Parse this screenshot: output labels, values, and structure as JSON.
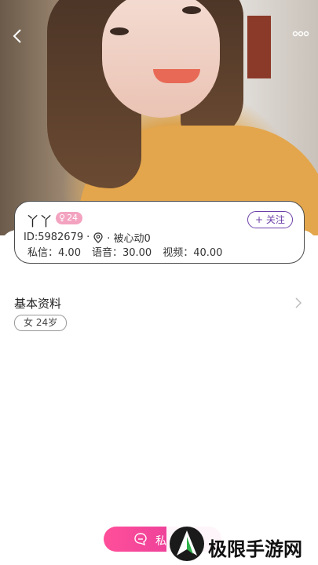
{
  "profile": {
    "name": "丫丫",
    "gender_symbol": "♀",
    "age_badge": "24",
    "id_text": "ID:5982679",
    "separator": "·",
    "liked_text": "· 被心动0",
    "follow_label": "+ 关注",
    "prices": [
      {
        "label": "私信：",
        "value": "4.00"
      },
      {
        "label": "语音：",
        "value": "30.00"
      },
      {
        "label": "视频：",
        "value": "40.00"
      }
    ]
  },
  "basic_info": {
    "title": "基本资料",
    "tag": "女 24岁"
  },
  "chat_button": {
    "label": "私"
  },
  "watermark": {
    "text": "极限手游网"
  },
  "icons": {
    "back": "back-arrow-icon",
    "more": "more-dots-icon",
    "location": "location-pin-icon",
    "chevron": "chevron-right-icon",
    "chat": "chat-bubble-icon"
  },
  "colors": {
    "accent_purple": "#6b3fa8",
    "badge_pink": "#f3a3c0",
    "chat_pink": "#ff4f9a"
  }
}
